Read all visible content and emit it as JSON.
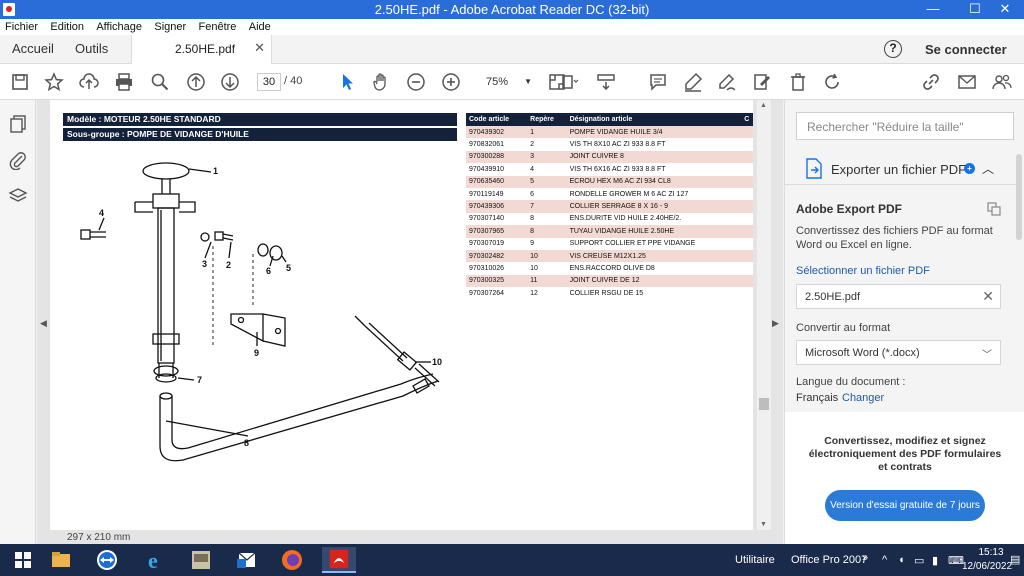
{
  "window": {
    "title": "2.50HE.pdf - Adobe Acrobat Reader DC (32-bit)",
    "minimize": "—",
    "maximize": "☐",
    "close": "✕"
  },
  "menubar": [
    "Fichier",
    "Edition",
    "Affichage",
    "Signer",
    "Fenêtre",
    "Aide"
  ],
  "tabs": {
    "home": "Accueil",
    "tools": "Outils",
    "document": "2.50HE.pdf",
    "help": "?",
    "login": "Se connecter"
  },
  "toolbar": {
    "page_current": "30",
    "page_total": "/ 40",
    "zoom": "75%"
  },
  "document": {
    "model_header": "Modèle : MOTEUR 2.50HE STANDARD",
    "subgroup_header": "Sous-groupe : POMPE DE VIDANGE D'HUILE",
    "page_size": "297 x 210 mm",
    "diagram_labels": [
      "1",
      "2",
      "3",
      "4",
      "5",
      "6",
      "7",
      "8",
      "9",
      "10"
    ],
    "table": {
      "headers": [
        "Code article",
        "Repère",
        "Désignation article",
        "C"
      ],
      "rows": [
        {
          "code": "970439302",
          "rep": "1",
          "des": "POMPE VIDANGE HUILE 3/4"
        },
        {
          "code": "970832061",
          "rep": "2",
          "des": "VIS TH 8X10 AC ZI 933 8.8 FT"
        },
        {
          "code": "970300288",
          "rep": "3",
          "des": "JOINT CUIVRE 8"
        },
        {
          "code": "970439910",
          "rep": "4",
          "des": "VIS TH 6X16 AC ZI 933 8.8 FT"
        },
        {
          "code": "970635460",
          "rep": "5",
          "des": "ECROU HEX M6 AC ZI 934 CL8"
        },
        {
          "code": "970119149",
          "rep": "6",
          "des": "RONDELLE GROWER M 6 AC ZI 127"
        },
        {
          "code": "970439306",
          "rep": "7",
          "des": "COLLIER SERRAGE 8 X 16 - 9"
        },
        {
          "code": "970307140",
          "rep": "8",
          "des": "ENS.DURITE VID HUILE 2.40HE/2."
        },
        {
          "code": "970307965",
          "rep": "8",
          "des": "TUYAU VIDANGE HUILE 2.50HE"
        },
        {
          "code": "970307019",
          "rep": "9",
          "des": "SUPPORT COLLIER ET PPE VIDANGE"
        },
        {
          "code": "970302482",
          "rep": "10",
          "des": "VIS CREUSE M12X1.25"
        },
        {
          "code": "970310026",
          "rep": "10",
          "des": "ENS.RACCORD OLIVE D8"
        },
        {
          "code": "970300325",
          "rep": "11",
          "des": "JOINT CUIVRE DE 12"
        },
        {
          "code": "970307264",
          "rep": "12",
          "des": "COLLIER RSGU DE 15"
        }
      ]
    }
  },
  "rightpanel": {
    "search_placeholder": "Rechercher \"Réduire la taille\"",
    "export_title": "Exporter un fichier PDF",
    "section_title": "Adobe Export PDF",
    "description": "Convertissez des fichiers PDF au format Word ou Excel en ligne.",
    "select_file": "Sélectionner un fichier PDF",
    "file_name": "2.50HE.pdf",
    "convert_label": "Convertir au format",
    "format_value": "Microsoft Word (*.docx)",
    "language_label": "Langue du document :",
    "language_value": "Français",
    "language_change": "Changer",
    "promo_text": "Convertissez, modifiez et signez électroniquement des PDF formulaires et contrats",
    "trial_button": "Version d'essai gratuite de 7 jours"
  },
  "taskbar": {
    "tray_label": "Utilitaire",
    "office": "Office Pro 2007",
    "time": "15:13",
    "date": "12/06/2022"
  },
  "colors": {
    "titlebar": "#2a6dd8",
    "table_header": "#14213a",
    "row_highlight": "#f3d9d3",
    "link": "#1f5aa8",
    "button": "#2b7ad8",
    "taskbar": "#1a2a4a"
  }
}
